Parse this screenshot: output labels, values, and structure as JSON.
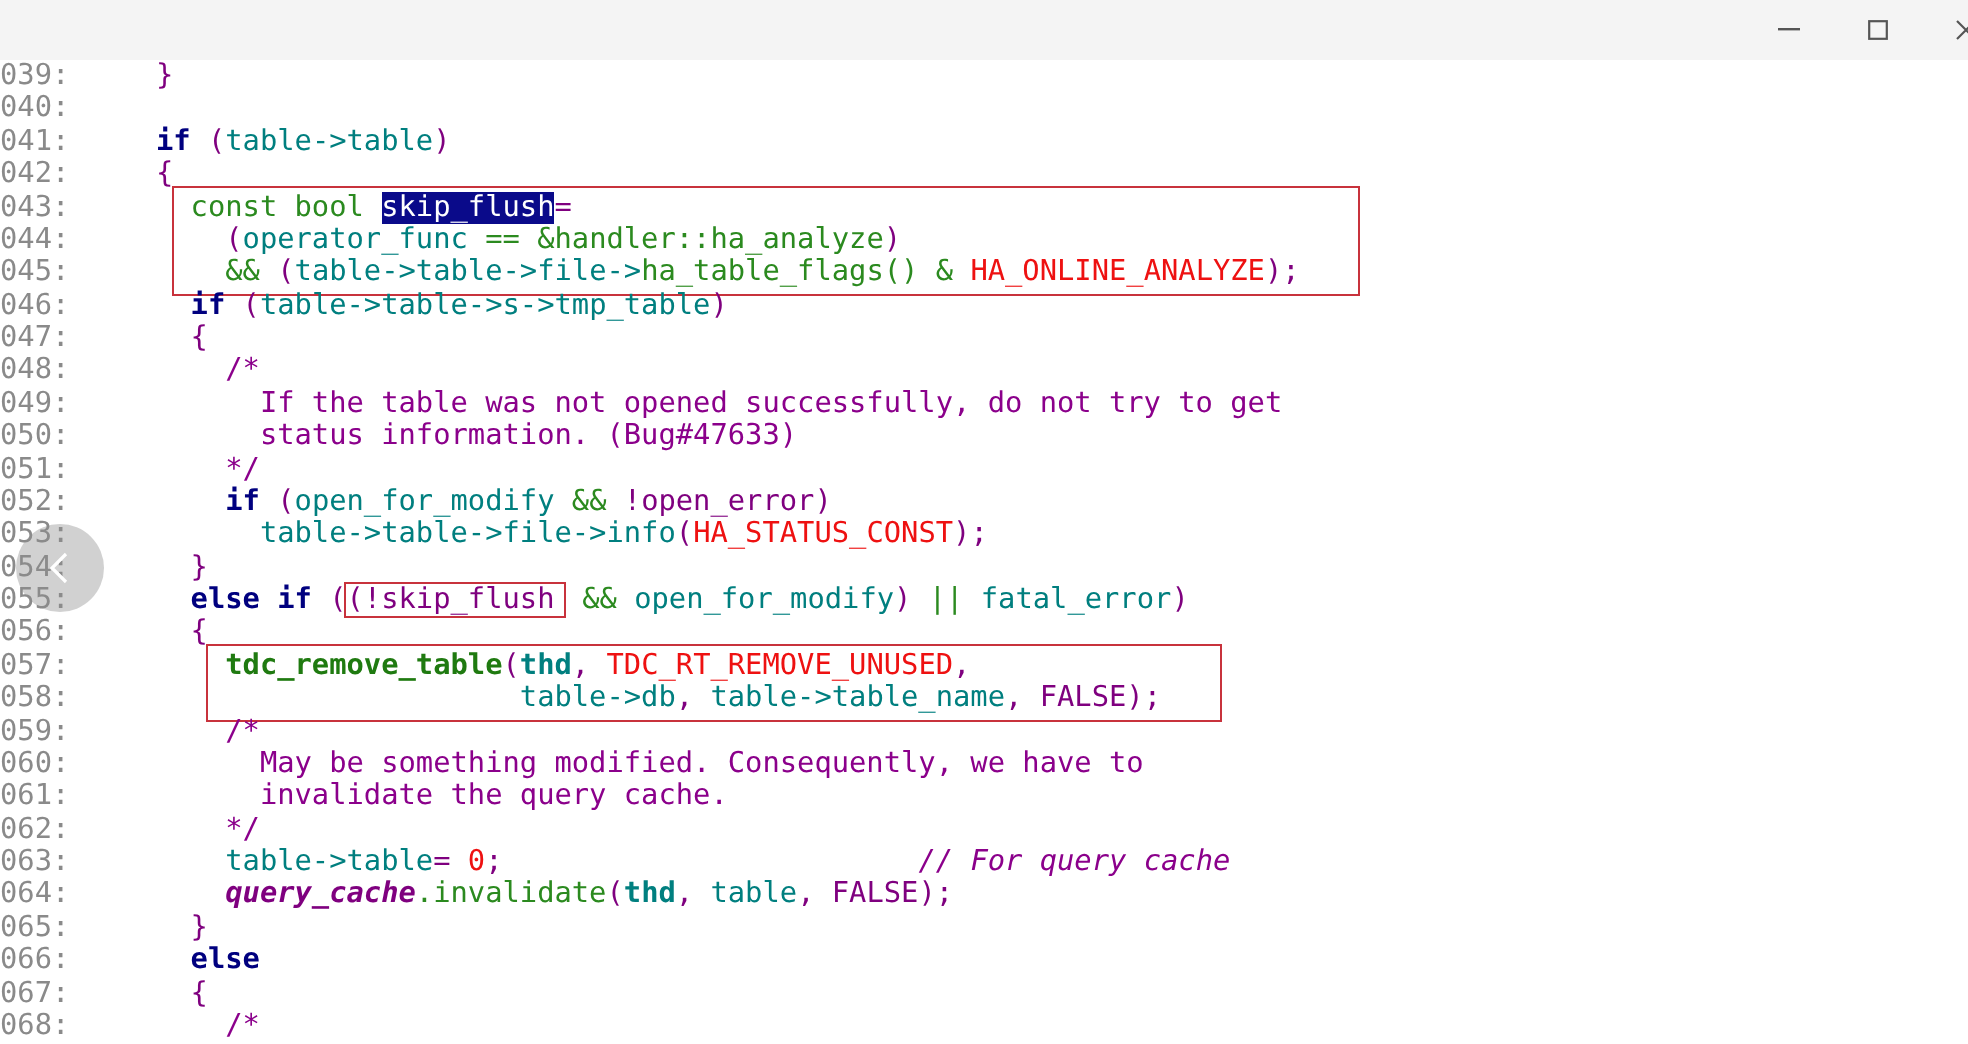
{
  "code": {
    "blocks": [
      {
        "boxed": false,
        "lines": [
          {
            "number": "039:",
            "tokens": [
              {
                "text": "     }",
                "kind": "punct"
              }
            ]
          },
          {
            "number": "040:"
          },
          {
            "number": "041:",
            "tokens": [
              {
                "text": "     if",
                "kind": "keyword"
              },
              {
                "text": " (",
                "kind": "punct"
              },
              {
                "text": "table->table",
                "kind": "ident"
              },
              {
                "text": ")",
                "kind": "punct"
              }
            ]
          },
          {
            "number": "042:",
            "tokens": [
              {
                "text": "     {",
                "kind": "punct"
              }
            ]
          }
        ]
      },
      {
        "boxed": true,
        "lines": [
          {
            "number": "043:",
            "tokens": [
              {
                "text": "       const bool ",
                "kind": "type"
              },
              {
                "text": "skip_flush",
                "kind": "selected"
              },
              {
                "text": "=",
                "kind": "punct"
              }
            ]
          },
          {
            "number": "044:",
            "tokens": [
              {
                "text": "         (",
                "kind": "punct"
              },
              {
                "text": "operator_func",
                "kind": "ident"
              },
              {
                "text": " == &handler::ha_analyze",
                "kind": "type"
              },
              {
                "text": ")",
                "kind": "punct"
              }
            ]
          },
          {
            "number": "045:",
            "tokens": [
              {
                "text": "         && ",
                "kind": "type"
              },
              {
                "text": "(",
                "kind": "punct"
              },
              {
                "text": "table->table->file->",
                "kind": "ident"
              },
              {
                "text": "ha_table_flags() & ",
                "kind": "type"
              },
              {
                "text": "HA_ONLINE_ANALYZE",
                "kind": "constant"
              },
              {
                "text": ");",
                "kind": "punct"
              }
            ]
          }
        ]
      },
      {
        "boxed": false,
        "lines": [
          {
            "number": "046:",
            "tokens": [
              {
                "text": "       if",
                "kind": "keyword"
              },
              {
                "text": " (",
                "kind": "punct"
              },
              {
                "text": "table->table->s->tmp_table",
                "kind": "ident"
              },
              {
                "text": ")",
                "kind": "punct"
              }
            ]
          },
          {
            "number": "047:",
            "tokens": [
              {
                "text": "       {",
                "kind": "punct"
              }
            ]
          },
          {
            "number": "048:",
            "tokens": [
              {
                "text": "         /*",
                "kind": "comment"
              }
            ]
          },
          {
            "number": "049:",
            "tokens": [
              {
                "text": "           If the table was not opened successfully, do not try to get",
                "kind": "comment"
              }
            ]
          },
          {
            "number": "050:",
            "tokens": [
              {
                "text": "           status information. (Bug#47633)",
                "kind": "comment"
              }
            ]
          },
          {
            "number": "051:",
            "tokens": [
              {
                "text": "         */",
                "kind": "comment"
              }
            ]
          },
          {
            "number": "052:",
            "tokens": [
              {
                "text": "         if",
                "kind": "keyword"
              },
              {
                "text": " (",
                "kind": "punct"
              },
              {
                "text": "open_for_modify",
                "kind": "ident"
              },
              {
                "text": " && ",
                "kind": "type"
              },
              {
                "text": "!open_error)",
                "kind": "punct"
              }
            ]
          },
          {
            "number": "053:",
            "tokens": [
              {
                "text": "           table->table->file->info",
                "kind": "ident"
              },
              {
                "text": "(",
                "kind": "punct"
              },
              {
                "text": "HA_STATUS_CONST",
                "kind": "constant"
              },
              {
                "text": ");",
                "kind": "punct"
              }
            ]
          },
          {
            "number": "054:",
            "tokens": [
              {
                "text": "       }",
                "kind": "punct"
              }
            ]
          },
          {
            "number": "055:",
            "tokens": [
              {
                "text": "       else if",
                "kind": "keyword"
              },
              {
                "text": " (",
                "kind": "punct"
              },
              {
                "text": "(!skip_flush",
                "kind": "boxed"
              },
              {
                "text": " && ",
                "kind": "type"
              },
              {
                "text": "open_for_modify",
                "kind": "ident"
              },
              {
                "text": ") ",
                "kind": "punct"
              },
              {
                "text": "|| ",
                "kind": "type"
              },
              {
                "text": "fatal_error",
                "kind": "ident"
              },
              {
                "text": ")",
                "kind": "punct"
              }
            ]
          },
          {
            "number": "056:",
            "tokens": [
              {
                "text": "       {",
                "kind": "punct"
              }
            ]
          }
        ]
      },
      {
        "boxed": true,
        "lines": [
          {
            "number": "057:",
            "tokens": [
              {
                "text": "         tdc_remove_table",
                "kind": "function"
              },
              {
                "text": "(",
                "kind": "punct"
              },
              {
                "text": "thd",
                "kind": "ident-bold"
              },
              {
                "text": ", ",
                "kind": "punct"
              },
              {
                "text": "TDC_RT_REMOVE_UNUSED",
                "kind": "constant"
              },
              {
                "text": ",",
                "kind": "punct"
              }
            ]
          },
          {
            "number": "058:",
            "tokens": [
              {
                "text": "                          table->db",
                "kind": "ident"
              },
              {
                "text": ", ",
                "kind": "punct"
              },
              {
                "text": "table->table_name",
                "kind": "ident"
              },
              {
                "text": ", FALSE);",
                "kind": "punct"
              }
            ]
          }
        ]
      },
      {
        "boxed": false,
        "lines": [
          {
            "number": "059:",
            "tokens": [
              {
                "text": "         /*",
                "kind": "comment"
              }
            ]
          },
          {
            "number": "060:",
            "tokens": [
              {
                "text": "           May be something modified. Consequently, we have to",
                "kind": "comment"
              }
            ]
          },
          {
            "number": "061:",
            "tokens": [
              {
                "text": "           invalidate the query cache.",
                "kind": "comment"
              }
            ]
          },
          {
            "number": "062:",
            "tokens": [
              {
                "text": "         */",
                "kind": "comment"
              }
            ]
          },
          {
            "number": "063:",
            "tokens": [
              {
                "text": "         table->table",
                "kind": "ident"
              },
              {
                "text": "= ",
                "kind": "punct"
              },
              {
                "text": "0",
                "kind": "constant"
              },
              {
                "text": ";                        ",
                "kind": "punct"
              },
              {
                "text": "// For query cache",
                "kind": "comment-italic"
              }
            ]
          },
          {
            "number": "064:",
            "tokens": [
              {
                "text": "         query_cache",
                "kind": "variable"
              },
              {
                "text": ".invalidate",
                "kind": "type"
              },
              {
                "text": "(",
                "kind": "punct"
              },
              {
                "text": "thd",
                "kind": "ident-bold"
              },
              {
                "text": ", ",
                "kind": "punct"
              },
              {
                "text": "table",
                "kind": "ident"
              },
              {
                "text": ", FALSE);",
                "kind": "punct"
              }
            ]
          },
          {
            "number": "065:",
            "tokens": [
              {
                "text": "       }",
                "kind": "punct"
              }
            ]
          },
          {
            "number": "066:",
            "tokens": [
              {
                "text": "       else",
                "kind": "keyword"
              }
            ]
          },
          {
            "number": "067:",
            "tokens": [
              {
                "text": "       {",
                "kind": "punct"
              }
            ]
          },
          {
            "number": "068:",
            "tokens": [
              {
                "text": "         /*",
                "kind": "comment"
              }
            ]
          }
        ]
      }
    ]
  }
}
